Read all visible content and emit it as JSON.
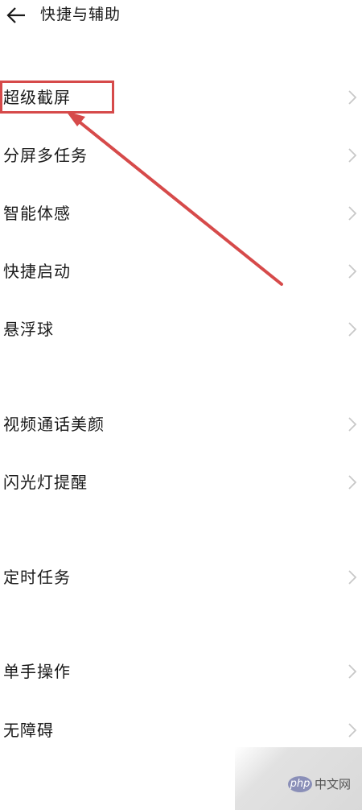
{
  "header": {
    "back_icon": "arrow-left-icon",
    "title": "快捷与辅助"
  },
  "menu": {
    "items": [
      {
        "label": "超级截屏",
        "icon": "chevron-right-icon",
        "highlighted": true
      },
      {
        "label": "分屏多任务",
        "icon": "chevron-right-icon"
      },
      {
        "label": "智能体感",
        "icon": "chevron-right-icon"
      },
      {
        "label": "快捷启动",
        "icon": "chevron-right-icon"
      },
      {
        "label": "悬浮球",
        "icon": "chevron-right-icon"
      },
      {
        "label": "视频通话美颜",
        "icon": "chevron-right-icon"
      },
      {
        "label": "闪光灯提醒",
        "icon": "chevron-right-icon"
      },
      {
        "label": "定时任务",
        "icon": "chevron-right-icon"
      },
      {
        "label": "单手操作",
        "icon": "chevron-right-icon"
      },
      {
        "label": "无障碍",
        "icon": "chevron-right-icon"
      }
    ]
  },
  "annotation": {
    "color": "#d64a4a"
  },
  "watermark": {
    "logo": "php",
    "text": "中文网"
  },
  "colors": {
    "text": "#1a1a1a",
    "chevron": "#c8c8c8",
    "background": "#ffffff"
  }
}
